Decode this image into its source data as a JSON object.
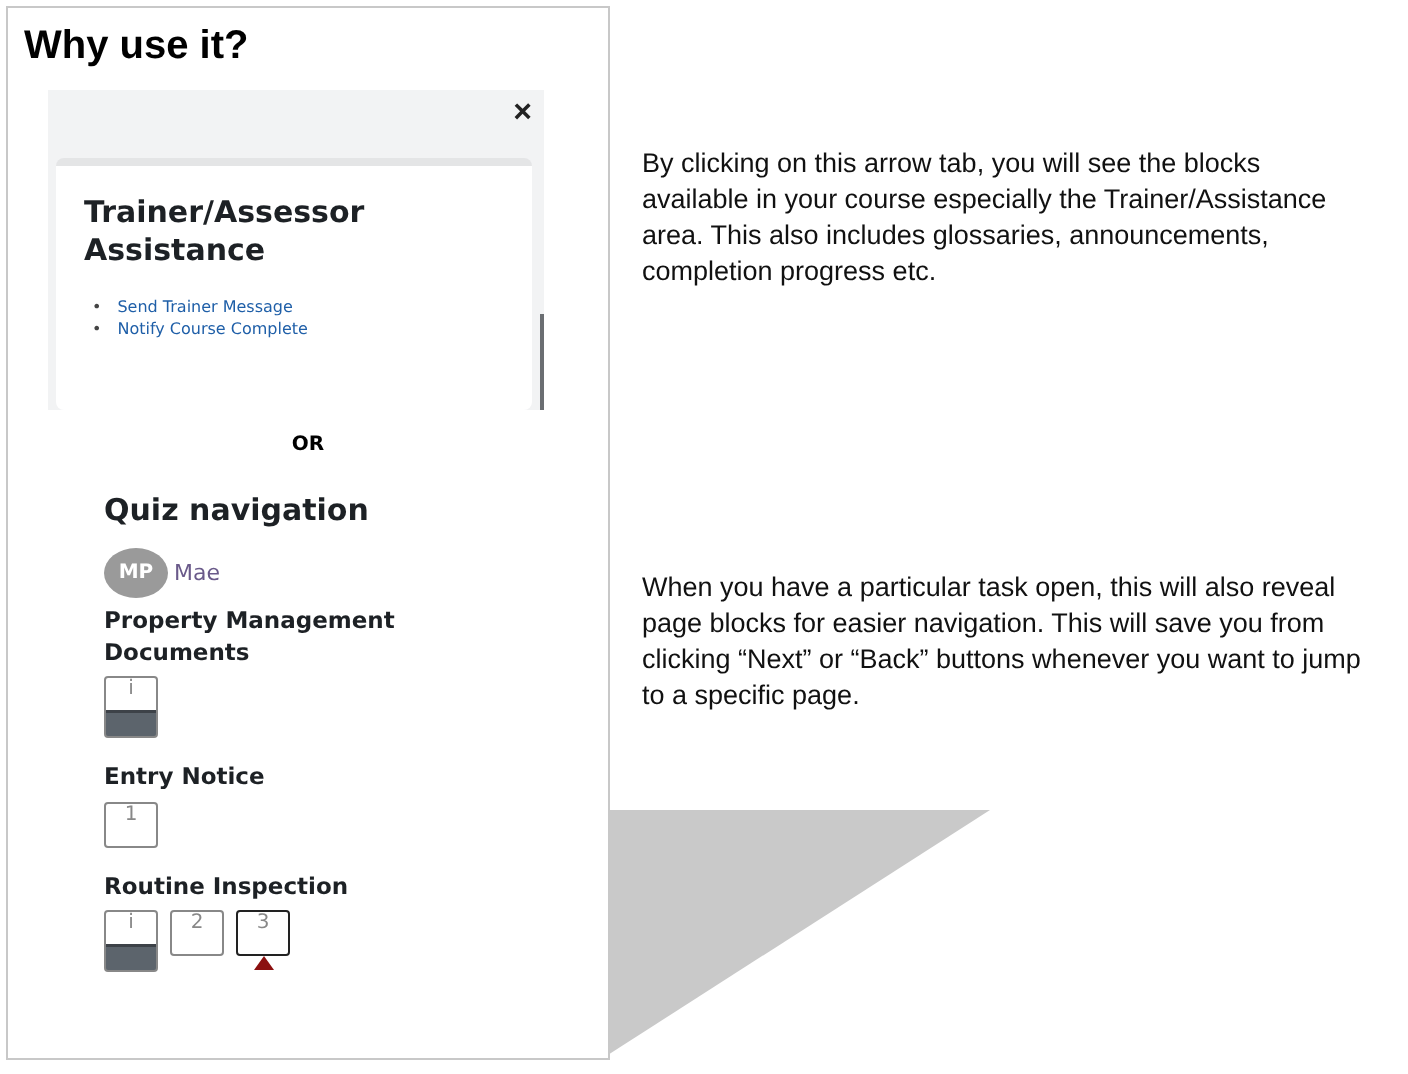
{
  "title": "Why use it?",
  "block": {
    "close": "×",
    "heading": "Trainer/Assessor Assistance",
    "links": [
      {
        "bullet": "•",
        "text": "Send Trainer Message"
      },
      {
        "bullet": "•",
        "text": "Notify Course Complete"
      }
    ]
  },
  "separator": "OR",
  "quiz_navigation": {
    "heading": "Quiz navigation",
    "user": {
      "initials": "MP",
      "name": "Mae"
    },
    "sections": [
      {
        "title": "Property Management Documents",
        "buttons": [
          {
            "label": "i",
            "answered": true,
            "current": false
          }
        ]
      },
      {
        "title": "Entry Notice",
        "buttons": [
          {
            "label": "1",
            "answered": false,
            "current": false
          }
        ]
      },
      {
        "title": "Routine Inspection",
        "buttons": [
          {
            "label": "i",
            "answered": true,
            "current": false
          },
          {
            "label": "2",
            "answered": false,
            "current": false
          },
          {
            "label": "3",
            "answered": false,
            "current": true
          }
        ]
      }
    ]
  },
  "notes": [
    "By clicking on this arrow tab, you will see the blocks available in your course especially the Trainer/Assistance area. This also includes glossaries, announcements, completion progress etc.",
    "When you have a particular task open, this will also reveal page blocks for easier navigation. This will save you from clicking “Next” or “Back” buttons whenever you want to jump to a specific page."
  ]
}
